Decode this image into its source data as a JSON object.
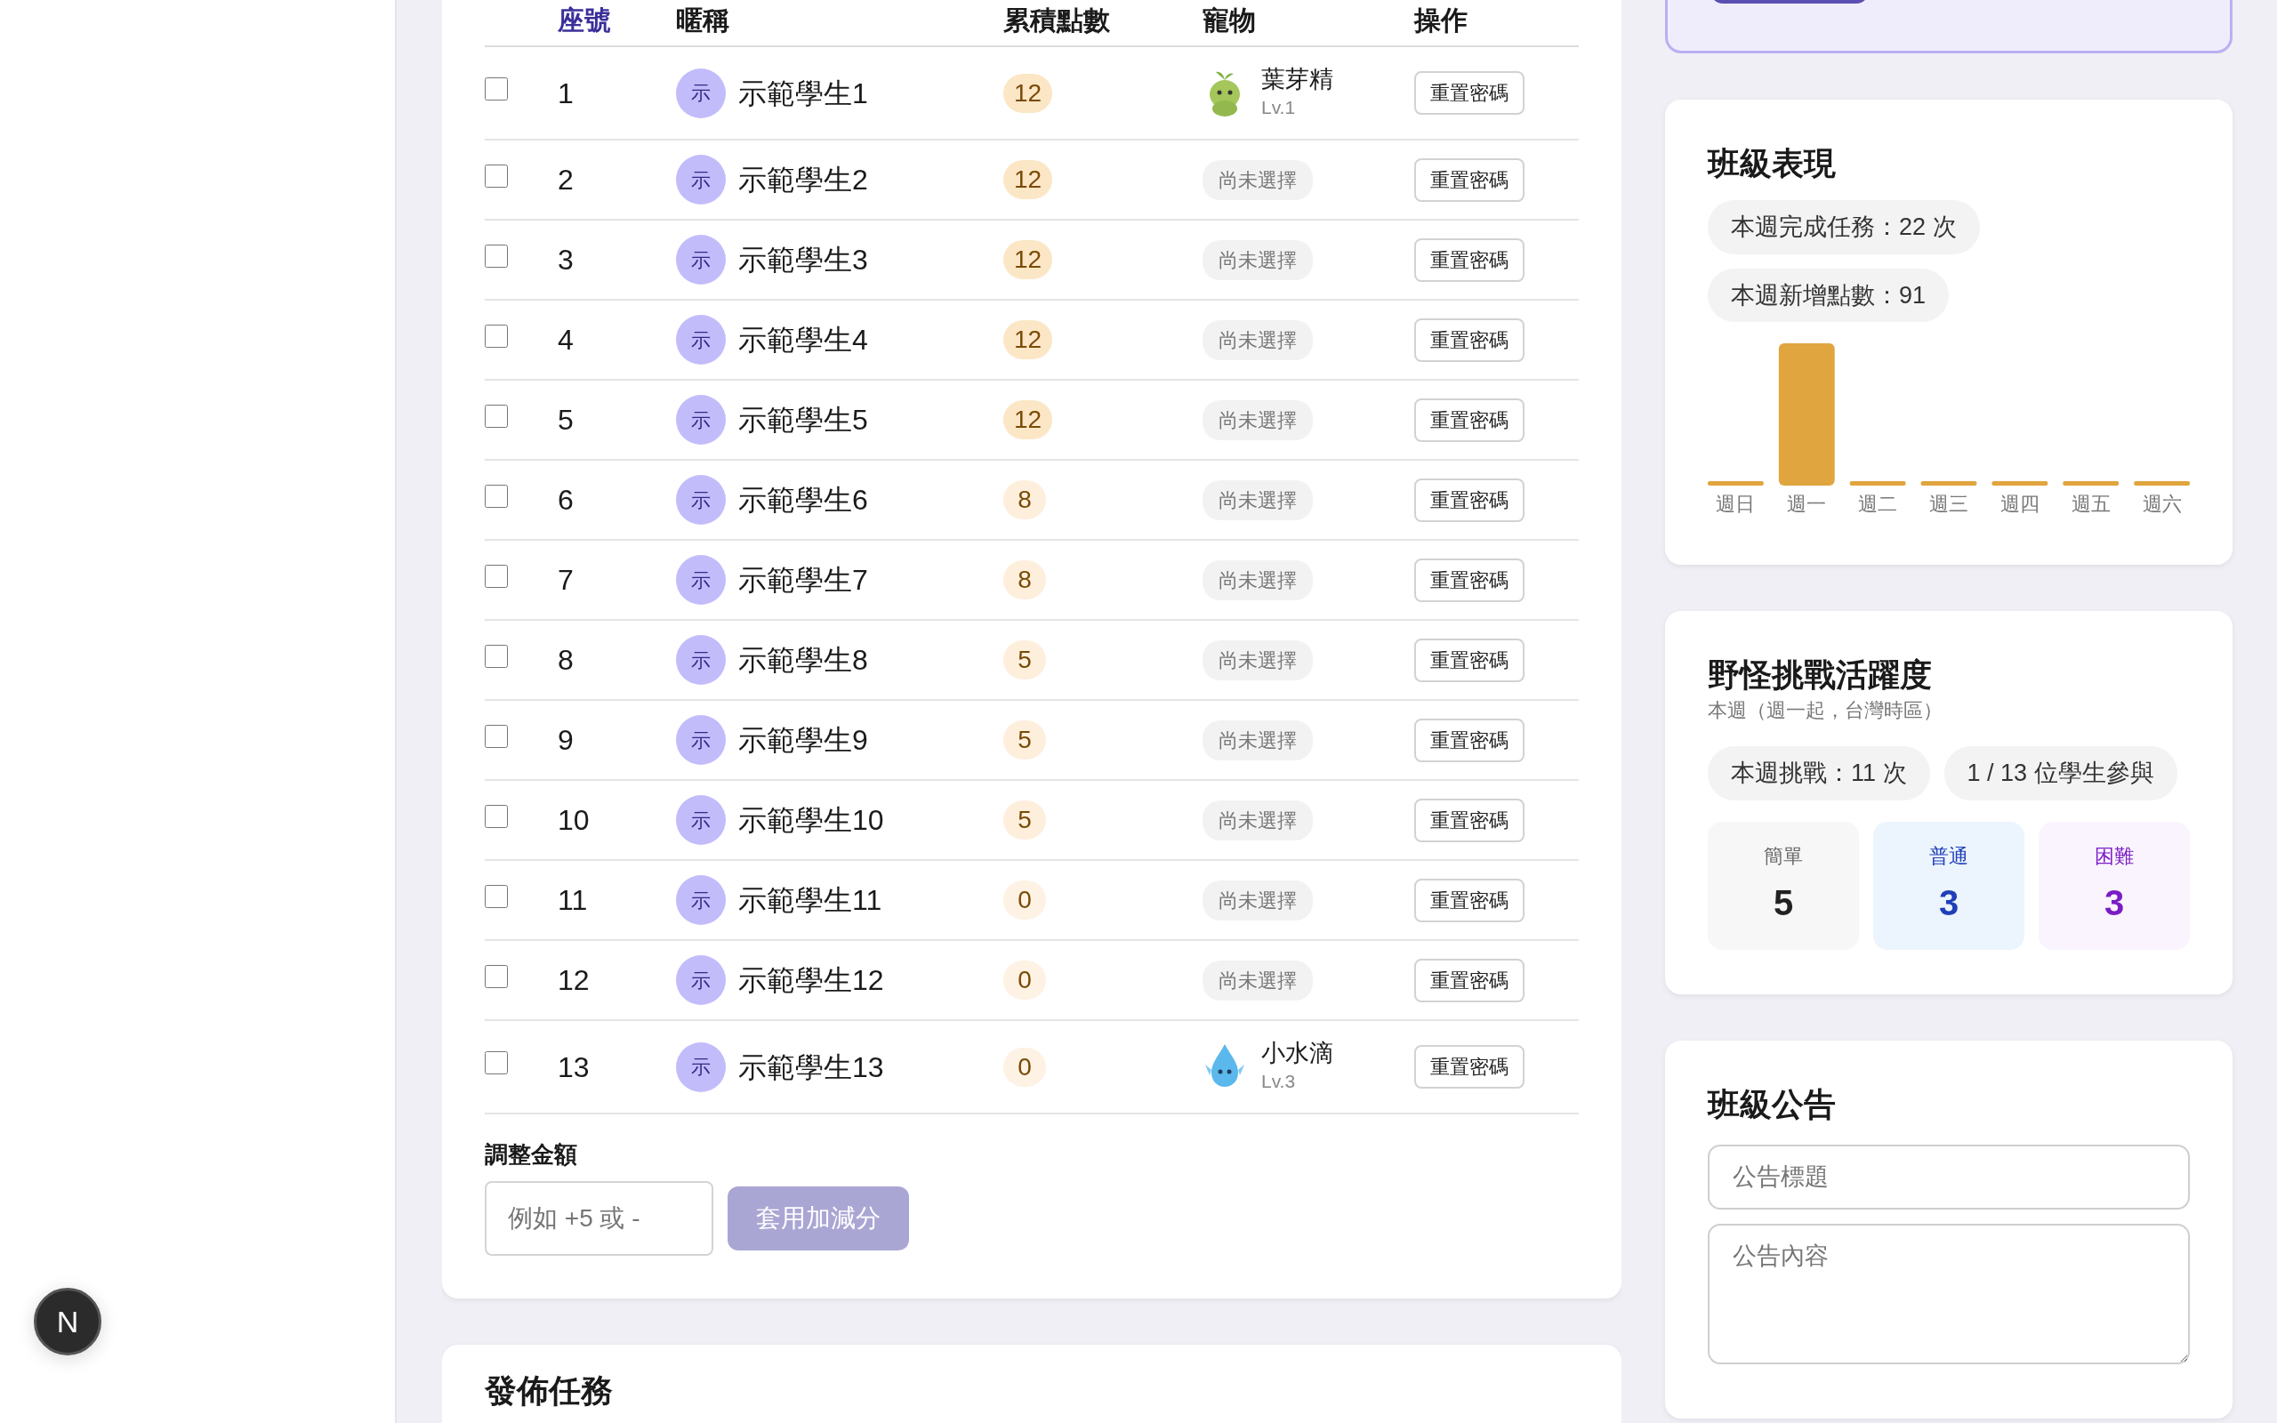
{
  "dev_badge": "N",
  "roster": {
    "columns": [
      {
        "label": "座號",
        "sorted": true
      },
      {
        "label": "暱稱",
        "sorted": false
      },
      {
        "label": "累積點數",
        "sorted": false
      },
      {
        "label": "寵物",
        "sorted": false
      },
      {
        "label": "操作",
        "sorted": false
      }
    ],
    "rows": [
      {
        "checked": false,
        "seat": "1",
        "avatar": "示",
        "name": "示範學生1",
        "points": "12",
        "pet": {
          "kind": "sprout",
          "name": "葉芽精",
          "level_text": "Lv.1"
        },
        "action": "重置密碼"
      },
      {
        "checked": false,
        "seat": "2",
        "avatar": "示",
        "name": "示範學生2",
        "points": "12",
        "pet": {
          "kind": "none",
          "name": "尚未選擇"
        },
        "action": "重置密碼"
      },
      {
        "checked": false,
        "seat": "3",
        "avatar": "示",
        "name": "示範學生3",
        "points": "12",
        "pet": {
          "kind": "none",
          "name": "尚未選擇"
        },
        "action": "重置密碼"
      },
      {
        "checked": false,
        "seat": "4",
        "avatar": "示",
        "name": "示範學生4",
        "points": "12",
        "pet": {
          "kind": "none",
          "name": "尚未選擇"
        },
        "action": "重置密碼"
      },
      {
        "checked": false,
        "seat": "5",
        "avatar": "示",
        "name": "示範學生5",
        "points": "12",
        "pet": {
          "kind": "none",
          "name": "尚未選擇"
        },
        "action": "重置密碼"
      },
      {
        "checked": false,
        "seat": "6",
        "avatar": "示",
        "name": "示範學生6",
        "points": "8",
        "pet": {
          "kind": "none",
          "name": "尚未選擇"
        },
        "action": "重置密碼"
      },
      {
        "checked": false,
        "seat": "7",
        "avatar": "示",
        "name": "示範學生7",
        "points": "8",
        "pet": {
          "kind": "none",
          "name": "尚未選擇"
        },
        "action": "重置密碼"
      },
      {
        "checked": false,
        "seat": "8",
        "avatar": "示",
        "name": "示範學生8",
        "points": "5",
        "pet": {
          "kind": "none",
          "name": "尚未選擇"
        },
        "action": "重置密碼"
      },
      {
        "checked": false,
        "seat": "9",
        "avatar": "示",
        "name": "示範學生9",
        "points": "5",
        "pet": {
          "kind": "none",
          "name": "尚未選擇"
        },
        "action": "重置密碼"
      },
      {
        "checked": false,
        "seat": "10",
        "avatar": "示",
        "name": "示範學生10",
        "points": "5",
        "pet": {
          "kind": "none",
          "name": "尚未選擇"
        },
        "action": "重置密碼"
      },
      {
        "checked": false,
        "seat": "11",
        "avatar": "示",
        "name": "示範學生11",
        "points": "0",
        "pet": {
          "kind": "none",
          "name": "尚未選擇"
        },
        "action": "重置密碼"
      },
      {
        "checked": false,
        "seat": "12",
        "avatar": "示",
        "name": "示範學生12",
        "points": "0",
        "pet": {
          "kind": "none",
          "name": "尚未選擇"
        },
        "action": "重置密碼"
      },
      {
        "checked": false,
        "seat": "13",
        "avatar": "示",
        "name": "示範學生13",
        "points": "0",
        "pet": {
          "kind": "droplet",
          "name": "小水滴",
          "level_text": "Lv.3"
        },
        "action": "重置密碼"
      }
    ],
    "adjust": {
      "label": "調整金額",
      "placeholder": "例如 +5 或 -",
      "button": "套用加減分",
      "disabled": true
    }
  },
  "next_card": {
    "title": "發佈任務"
  },
  "class_performance": {
    "title": "班級表現",
    "pills": [
      "本週完成任務：22 次",
      "本週新增點數：91"
    ],
    "day_labels": [
      "週日",
      "週一",
      "週二",
      "週三",
      "週四",
      "週五",
      "週六"
    ]
  },
  "monster_challenge": {
    "title": "野怪挑戰活躍度",
    "subtitle": "本週（週一起，台灣時區）",
    "pills": [
      "本週挑戰：11 次",
      "1 / 13 位學生參與"
    ],
    "difficulties": [
      {
        "kind": "easy",
        "label": "簡單",
        "count": "5"
      },
      {
        "kind": "normal",
        "label": "普通",
        "count": "3"
      },
      {
        "kind": "hard",
        "label": "困難",
        "count": "3"
      }
    ]
  },
  "announcement": {
    "title": "班級公告",
    "title_placeholder": "公告標題",
    "body_placeholder": "公告內容"
  }
}
